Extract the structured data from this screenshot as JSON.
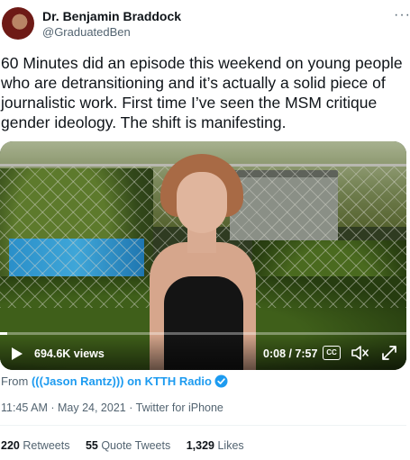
{
  "author": {
    "name": "Dr. Benjamin Braddock",
    "handle": "@GraduatedBen"
  },
  "more_label": "···",
  "tweet": {
    "text": "60 Minutes did an episode this weekend on young people who are detransitioning and it’s actually a solid piece of journalistic work. First time I’ve seen the MSM critique gender ideology. The shift is manifesting."
  },
  "video": {
    "views": "694.6K views",
    "time": "0:08 / 7:57",
    "cc_label": "CC",
    "progress_fraction": 0.017
  },
  "source": {
    "prefix": "From ",
    "name": "(((Jason Rantz))) on KTTH Radio"
  },
  "meta": {
    "timestamp": "11:45 AM · May 24, 2021 · Twitter for iPhone"
  },
  "stats": {
    "retweets_count": "220",
    "retweets_label": "Retweets",
    "quotes_count": "55",
    "quotes_label": "Quote Tweets",
    "likes_count": "1,329",
    "likes_label": "Likes"
  },
  "colors": {
    "accent": "#1d9bf0",
    "text_primary": "#0f1419",
    "text_secondary": "#536471"
  }
}
